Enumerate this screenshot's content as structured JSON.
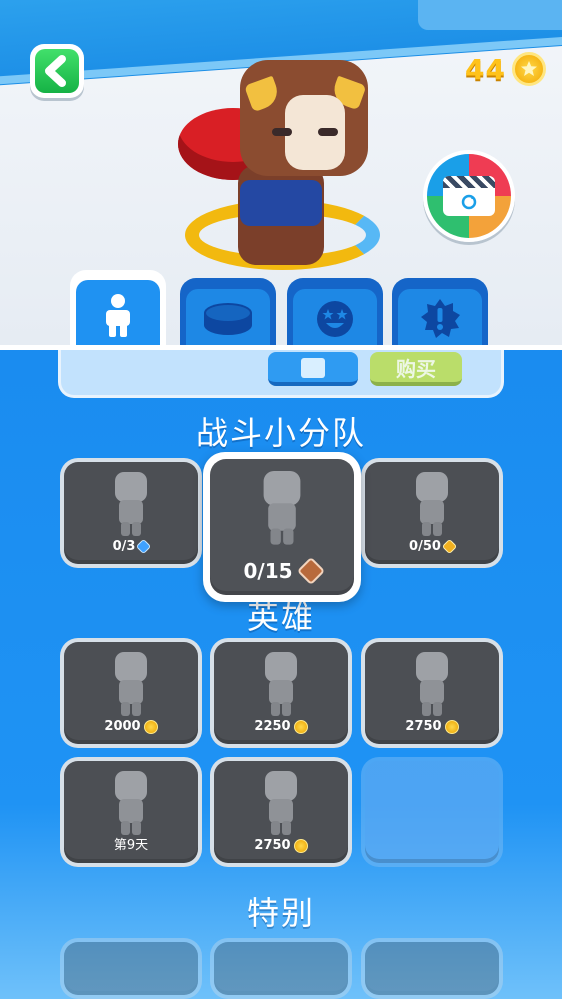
{
  "currency": {
    "coins": "44"
  },
  "tabs": [
    {
      "name": "characters",
      "icon": "person-icon",
      "active": true
    },
    {
      "name": "platforms",
      "icon": "disc-icon",
      "active": false
    },
    {
      "name": "emotes",
      "icon": "star-eyes-emoji-icon",
      "active": false
    },
    {
      "name": "effects",
      "icon": "burst-badge-icon",
      "active": false
    }
  ],
  "preview_strip": {
    "buy_label": "购买"
  },
  "sections": {
    "squad": {
      "title": "战斗小分队"
    },
    "heroes": {
      "title": "英雄"
    },
    "special": {
      "title": "特别"
    }
  },
  "squad_cards": [
    {
      "price": "0/3",
      "currency_icon": "blue-gem-icon"
    },
    {
      "price": "0/15",
      "currency_icon": "brown-gem-icon",
      "selected": true
    },
    {
      "price": "0/50",
      "currency_icon": "gold-gem-icon"
    }
  ],
  "hero_cards": [
    {
      "price": "2000",
      "currency_icon": "coin-icon"
    },
    {
      "price": "2250",
      "currency_icon": "coin-icon"
    },
    {
      "price": "2750",
      "currency_icon": "coin-icon"
    },
    {
      "price": "第9天",
      "currency_icon": ""
    },
    {
      "price": "2750",
      "currency_icon": "coin-icon"
    }
  ],
  "colors": {
    "panel_blue": "#1f93f4",
    "card_dark": "#4c4f54",
    "coin_gold": "#ffc21a",
    "back_green": "#16b245"
  }
}
